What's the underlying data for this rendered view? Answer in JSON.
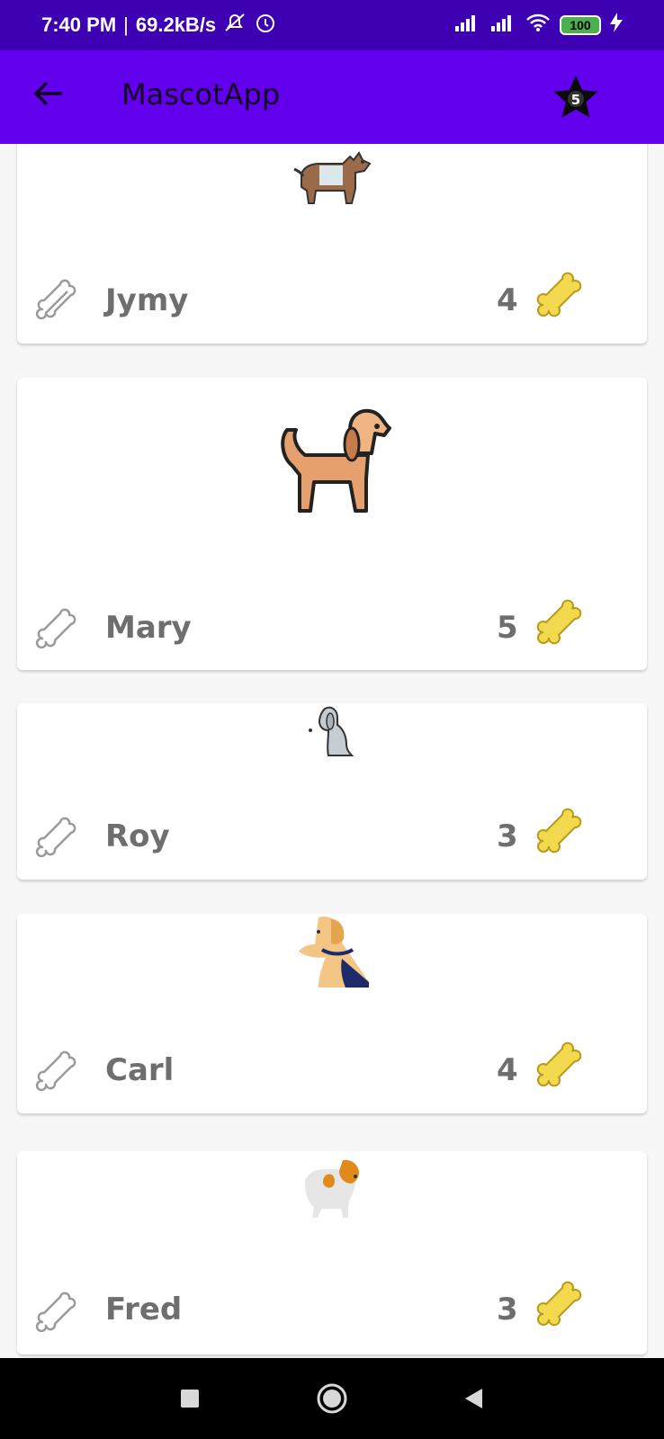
{
  "status_bar": {
    "time": "7:40 PM",
    "network_speed": "69.2kB/s",
    "battery": "100",
    "icons": [
      "mute-icon",
      "alarm-icon",
      "signal-icon",
      "signal-icon",
      "wifi-icon",
      "battery-icon",
      "charging-icon"
    ]
  },
  "app_bar": {
    "title": "MascotApp",
    "back_icon": "arrow-left-icon",
    "favorites_icon": "star-icon",
    "favorites_badge": "5",
    "colors": {
      "primary": "#6200ee",
      "status": "#3d00b3"
    }
  },
  "pets": [
    {
      "name": "Jymy",
      "rating": "4",
      "image": "dog-husky-icon"
    },
    {
      "name": "Mary",
      "rating": "5",
      "image": "dog-orange-icon"
    },
    {
      "name": "Roy",
      "rating": "3",
      "image": "dog-sitting-icon"
    },
    {
      "name": "Carl",
      "rating": "4",
      "image": "dog-labrador-icon"
    },
    {
      "name": "Fred",
      "rating": "3",
      "image": "dog-papillon-icon"
    }
  ],
  "nav": {
    "buttons": [
      "square-icon",
      "circle-icon",
      "triangle-back-icon"
    ]
  }
}
